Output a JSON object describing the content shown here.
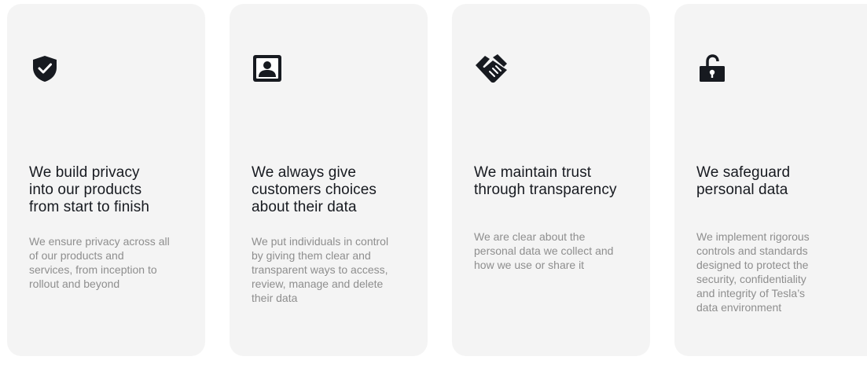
{
  "cards": [
    {
      "icon": "shield-check-icon",
      "title_lines": [
        "We build privacy",
        "into our products",
        "from start to finish"
      ],
      "description_lines": [
        "We ensure privacy across all",
        "of our products and",
        "services, from inception to",
        "rollout and beyond"
      ]
    },
    {
      "icon": "user-portrait-icon",
      "title_lines": [
        "We always give",
        "customers choices",
        "about their data"
      ],
      "description_lines": [
        "We put individuals in control",
        "by giving them clear and",
        "transparent ways to access,",
        "review, manage and delete",
        "their data"
      ]
    },
    {
      "icon": "handshake-icon",
      "title_lines": [
        "We maintain trust",
        "through transparency"
      ],
      "description_lines": [
        "We are clear about the",
        "personal data we collect and",
        "how we use or share it"
      ]
    },
    {
      "icon": "unlocked-padlock-icon",
      "title_lines": [
        "We safeguard",
        "personal data"
      ],
      "description_lines": [
        "We implement rigorous",
        "controls and standards",
        "designed to protect the",
        "security, confidentiality",
        "and integrity of Tesla’s",
        "data environment"
      ]
    }
  ],
  "colors": {
    "card_background": "#f4f4f4",
    "title": "#171a20",
    "description": "#8e8e8e",
    "icon": "#171a20"
  }
}
